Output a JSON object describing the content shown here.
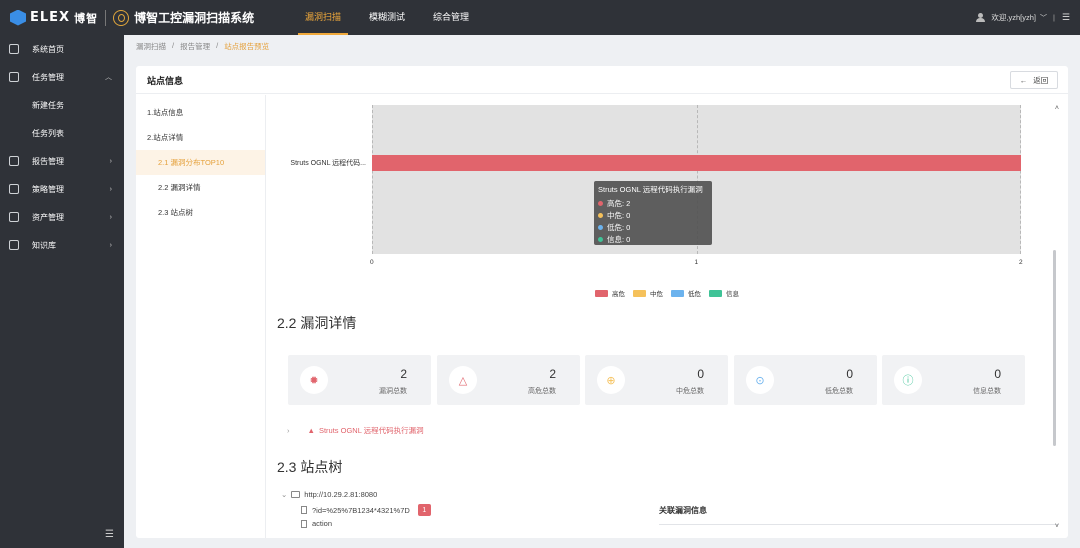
{
  "header": {
    "brand_logo": "ELEX",
    "brand_cn": "博智",
    "app_title": "博智工控漏洞扫描系统",
    "nav": [
      "漏洞扫描",
      "模糊测试",
      "综合管理"
    ],
    "active_nav": "漏洞扫描",
    "user": "欢迎,yzh[yzh]"
  },
  "sidebar": {
    "items": [
      {
        "label": "系统首页",
        "icon": "home-icon"
      },
      {
        "label": "任务管理",
        "icon": "task-icon"
      },
      {
        "label": "新建任务"
      },
      {
        "label": "任务列表"
      },
      {
        "label": "报告管理",
        "icon": "report-icon"
      },
      {
        "label": "策略管理",
        "icon": "policy-icon"
      },
      {
        "label": "资产管理",
        "icon": "asset-icon"
      },
      {
        "label": "知识库",
        "icon": "knowledge-icon"
      }
    ]
  },
  "breadcrumb": [
    "漏洞扫描",
    "报告管理",
    "站点报告预览"
  ],
  "card": {
    "title": "站点信息",
    "back_label": "返回"
  },
  "toc": [
    "1.站点信息",
    "2.站点详情",
    "2.1 漏洞分布TOP10",
    "2.2 漏洞详情",
    "2.3 站点树"
  ],
  "chart_data": {
    "type": "bar",
    "orientation": "horizontal",
    "stacked": true,
    "categories": [
      "Struts OGNL 远程代码..."
    ],
    "series": [
      {
        "name": "高危",
        "values": [
          2
        ],
        "color": "#e1646c"
      },
      {
        "name": "中危",
        "values": [
          0
        ],
        "color": "#f5c15b"
      },
      {
        "name": "低危",
        "values": [
          0
        ],
        "color": "#6cb3ee"
      },
      {
        "name": "信息",
        "values": [
          0
        ],
        "color": "#3fc397"
      }
    ],
    "x_ticks": [
      "0",
      "1",
      "2"
    ],
    "xlim": [
      0,
      2
    ],
    "grid": true,
    "legend_position": "bottom",
    "tooltip": {
      "title": "Struts OGNL 远程代码执行漏洞",
      "rows": [
        "高危: 2",
        "中危: 0",
        "低危: 0",
        "信息: 0"
      ]
    }
  },
  "section_22": "2.2 漏洞详情",
  "stats": [
    {
      "value": "2",
      "label": "漏洞总数",
      "icon": "bug-icon",
      "color": "#e1646c"
    },
    {
      "value": "2",
      "label": "高危总数",
      "icon": "warning-icon",
      "color": "#e1646c"
    },
    {
      "value": "0",
      "label": "中危总数",
      "icon": "up-arrow-icon",
      "color": "#f5c15b"
    },
    {
      "value": "0",
      "label": "低危总数",
      "icon": "down-arrow-icon",
      "color": "#6cb3ee"
    },
    {
      "value": "0",
      "label": "信息总数",
      "icon": "info-icon",
      "color": "#3fc397"
    }
  ],
  "vuln_item": "Struts OGNL 远程代码执行漏洞",
  "section_23": "2.3 站点树",
  "tree": {
    "root": "http://10.29.2.81:8080",
    "children": [
      "?id=%25%7B1234*4321%7D",
      "action"
    ],
    "badge": "1"
  },
  "assoc_title": "关联漏洞信息"
}
